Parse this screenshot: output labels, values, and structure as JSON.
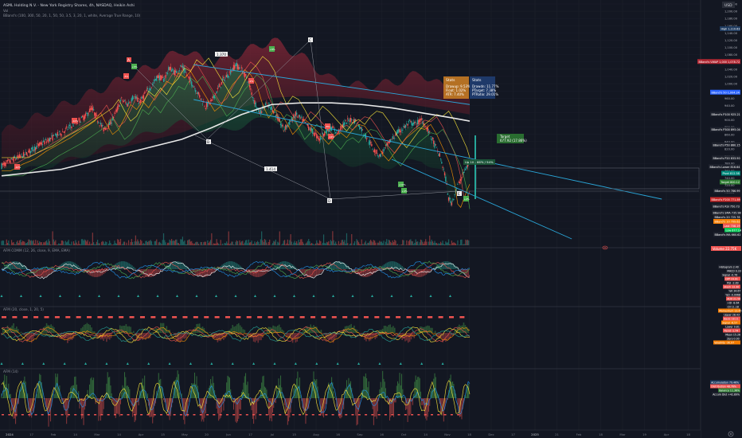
{
  "header": {
    "title": "ASML Holding N.V. - New York Registry Shares, 4h, NASDAQ, Heikin Ashi",
    "line2": "Vol",
    "line3": "BBand's (100, 300, 50, 20, 1, 50, 50, 3.5, 3, 20, 1, white, Average True Range, 10)"
  },
  "currency": "USD",
  "colors": {
    "bg": "#131722",
    "up": "#26a69a",
    "down": "#ef5350",
    "grid": "#1e222d",
    "band_red": "#6b1f2c",
    "band_green": "#1d5a3e",
    "ma_white": "#e0e0e0",
    "trend": "#2aa6d8"
  },
  "time_axis": [
    "2024",
    "17",
    "Feb",
    "14",
    "Mar",
    "14",
    "Apr",
    "15",
    "May",
    "20",
    "Jun",
    "17",
    "Jul",
    "15",
    "Aug",
    "16",
    "Sep",
    "16",
    "Oct",
    "14",
    "Nov",
    "18",
    "Dec",
    "17",
    "2025",
    "21",
    "Feb",
    "18",
    "Mar",
    "19",
    "Apr",
    "18"
  ],
  "price_axis": [
    "1,220.00",
    "1,200.00",
    "1,180.00",
    "1,160.00",
    "1,140.00",
    "1,120.00",
    "1,100.00",
    "1,080.00",
    "1,060.00",
    "1,040.00",
    "1,020.00",
    "1,000.00",
    "980.00",
    "960.00",
    "940.00",
    "920.00",
    "900.00",
    "880.00",
    "860.00",
    "840.00",
    "820.00",
    "800.00",
    "780.00",
    "760.00",
    "740.00",
    "720.00",
    "700.00",
    "680.00",
    "660.00",
    "640.00",
    "620.00",
    "600.00",
    "580.00"
  ],
  "price_badges": [
    {
      "text": "High 1,110.63",
      "color": "#1e3a5f",
      "y": 0.96
    },
    {
      "text": "BBand's VWAP 1,000 1,078.72",
      "color": "#b22833",
      "y": 0.81
    },
    {
      "text": "BBand's 50 1,004.24",
      "color": "#2962ff",
      "y": 0.67
    },
    {
      "text": "BBand's P100 925.21",
      "color": "#1e222d",
      "y": 0.57
    },
    {
      "text": "BBand's P300 895.04",
      "color": "#1e222d",
      "y": 0.5
    },
    {
      "text": "BBand's P50 860.15",
      "color": "#1e222d",
      "y": 0.43
    },
    {
      "text": "BBand's P20 833.90",
      "color": "#1e222d",
      "y": 0.37
    },
    {
      "text": "BBand's Lower 816.64",
      "color": "#1e222d",
      "y": 0.33
    },
    {
      "text": "Pivot 812.58",
      "color": "#00897b",
      "y": 0.3
    },
    {
      "text": "Target 800.12",
      "color": "#2e7d32",
      "y": 0.26
    },
    {
      "text": "BBand's 50 786.99",
      "color": "#1e222d",
      "y": 0.22
    },
    {
      "text": "BBand's P200 771.89",
      "color": "#c62828",
      "y": 0.18
    },
    {
      "text": "BBand's RSI 750.73",
      "color": "#1e222d",
      "y": 0.15
    },
    {
      "text": "BBand's SMA 735.98",
      "color": "#1e222d",
      "y": 0.12
    },
    {
      "text": "BBand's 20 725.78",
      "color": "#1e222d",
      "y": 0.1
    },
    {
      "text": "BBand's 10 709.62",
      "color": "#f57c00",
      "y": 0.08
    },
    {
      "text": "Last 708.19",
      "color": "#ef5350",
      "y": 0.06
    },
    {
      "text": "Low 677.14",
      "color": "#00c853",
      "y": 0.04
    },
    {
      "text": "BBand's MA 660.62",
      "color": "#1e222d",
      "y": 0.02
    }
  ],
  "annotations": {
    "zone_labels": [
      "-10%",
      "-10%",
      "-5%",
      "+5%",
      "-2%",
      "+8%",
      "-14%",
      "-8%",
      "+10%",
      "+4%",
      "+2%"
    ],
    "wave_labels": [
      "A",
      "B",
      "C",
      "D",
      "E"
    ],
    "ratio_labels": [
      "1.370",
      "1.414"
    ],
    "box_label": "Up 10 - 66% / 54%",
    "target_label_1": "Target",
    "target_label_2": "677.92 (17.86%)",
    "stats_box_orange": {
      "title": "Stats",
      "lines": [
        "Drawup: 9.53%",
        "Float: 1.02%",
        "ATR: 7.40%"
      ]
    },
    "stats_box_blue": {
      "title": "Stats",
      "lines": [
        "Drawdn: 11.77%",
        "PTarget: 7.38%",
        "PTRatio: 29.01%"
      ]
    },
    "volume_label": "Volume 22.75K"
  },
  "panes": {
    "p1": {
      "label": "AFM COMM (12, 26, close, 9, EMA, EMA)",
      "badges": [
        {
          "text": "Histogram 2.40",
          "color": "#1e222d"
        },
        {
          "text": "MACD 0.33",
          "color": "#1e222d"
        },
        {
          "text": "Signal -0.76",
          "color": "#1e222d"
        },
        {
          "text": "Diff 16.91",
          "color": "#ef5350"
        },
        {
          "text": "RSI -2.89",
          "color": "#1e222d"
        },
        {
          "text": "Stoch 12.30",
          "color": "#ef5350"
        },
        {
          "text": "%K 34.67",
          "color": "#1e222d"
        },
        {
          "text": "%D -0.0068",
          "color": "#1e222d"
        },
        {
          "text": "ADX 21.54",
          "color": "#ef5350"
        },
        {
          "text": "+DI -8.64",
          "color": "#1e222d"
        },
        {
          "text": "-DI 11.18",
          "color": "#1e222d"
        },
        {
          "text": "ATR 19.18",
          "color": "#1e222d"
        }
      ]
    },
    "p2": {
      "label": "AFM (20, close, 1, 20, 5)",
      "badges": [
        {
          "text": "Momentum 13.45",
          "color": "#f57c00"
        },
        {
          "text": "Upper 28.43",
          "color": "#1e222d"
        },
        {
          "text": "Basis 18.11",
          "color": "#ef5350"
        },
        {
          "text": "Signal -6.57",
          "color": "#f57c00"
        },
        {
          "text": "Lower 9.81",
          "color": "#1e222d"
        },
        {
          "text": "Trend -1.74",
          "color": "#ef5350"
        },
        {
          "text": "Mean 15.26",
          "color": "#1e222d"
        },
        {
          "text": "Zero 0.00",
          "color": "#1e222d"
        },
        {
          "text": "Volatility -30.97",
          "color": "#f57c00"
        }
      ]
    },
    "p3": {
      "label": "AFM (14)",
      "badges": [
        {
          "text": "Accumulation 79.46%",
          "color": "#1e3a5f"
        },
        {
          "text": "Distribution 48.76%",
          "color": "#ef5350"
        },
        {
          "text": "Balance 11.36%",
          "color": "#2e7d32"
        },
        {
          "text": "Accum Dist +42.89%",
          "color": "#1e222d"
        }
      ]
    }
  },
  "icons": [
    "settings-icon",
    "eye-icon"
  ],
  "chart_data": {
    "type": "candlestick",
    "title": "ASML Holding N.V. - New York Registry Shares, 4h, NASDAQ, Heikin Ashi",
    "ylim": [
      580,
      1240
    ],
    "price_path": [
      [
        0,
        800
      ],
      [
        4,
        820
      ],
      [
        8,
        835
      ],
      [
        12,
        860
      ],
      [
        16,
        880
      ],
      [
        20,
        900
      ],
      [
        24,
        925
      ],
      [
        28,
        950
      ],
      [
        30,
        975
      ],
      [
        32,
        940
      ],
      [
        34,
        910
      ],
      [
        36,
        925
      ],
      [
        38,
        960
      ],
      [
        40,
        1000
      ],
      [
        42,
        985
      ],
      [
        44,
        1010
      ],
      [
        46,
        990
      ],
      [
        48,
        1020
      ],
      [
        50,
        1040
      ],
      [
        52,
        1070
      ],
      [
        54,
        1060
      ],
      [
        56,
        1095
      ],
      [
        58,
        1080
      ],
      [
        60,
        1100
      ],
      [
        62,
        1070
      ],
      [
        64,
        1040
      ],
      [
        66,
        1010
      ],
      [
        68,
        980
      ],
      [
        70,
        995
      ],
      [
        72,
        1030
      ],
      [
        74,
        1060
      ],
      [
        76,
        1080
      ],
      [
        78,
        1105
      ],
      [
        80,
        1090
      ],
      [
        82,
        1060
      ],
      [
        84,
        1000
      ],
      [
        86,
        960
      ],
      [
        88,
        985
      ],
      [
        90,
        975
      ],
      [
        92,
        945
      ],
      [
        94,
        910
      ],
      [
        96,
        930
      ],
      [
        98,
        955
      ],
      [
        100,
        940
      ],
      [
        102,
        920
      ],
      [
        104,
        900
      ],
      [
        106,
        880
      ],
      [
        108,
        905
      ],
      [
        110,
        915
      ],
      [
        112,
        900
      ],
      [
        114,
        925
      ],
      [
        116,
        940
      ],
      [
        118,
        935
      ],
      [
        120,
        910
      ],
      [
        122,
        880
      ],
      [
        124,
        850
      ],
      [
        126,
        830
      ],
      [
        128,
        855
      ],
      [
        130,
        880
      ],
      [
        132,
        900
      ],
      [
        134,
        915
      ],
      [
        136,
        930
      ],
      [
        138,
        925
      ],
      [
        140,
        940
      ],
      [
        142,
        910
      ],
      [
        144,
        870
      ],
      [
        146,
        830
      ],
      [
        147,
        800
      ],
      [
        148,
        760
      ],
      [
        149,
        700
      ],
      [
        150,
        690
      ],
      [
        152,
        740
      ],
      [
        154,
        780
      ],
      [
        156,
        812
      ]
    ],
    "sma_path": [
      [
        0,
        770
      ],
      [
        20,
        790
      ],
      [
        40,
        835
      ],
      [
        60,
        880
      ],
      [
        70,
        915
      ],
      [
        80,
        955
      ],
      [
        90,
        985
      ],
      [
        100,
        990
      ],
      [
        110,
        990
      ],
      [
        120,
        985
      ],
      [
        130,
        975
      ],
      [
        140,
        960
      ],
      [
        150,
        945
      ],
      [
        156,
        935
      ]
    ],
    "band_upper": [
      [
        0,
        900
      ],
      [
        10,
        940
      ],
      [
        20,
        980
      ],
      [
        30,
        1020
      ],
      [
        40,
        1060
      ],
      [
        50,
        1100
      ],
      [
        60,
        1150
      ],
      [
        70,
        1110
      ],
      [
        80,
        1140
      ],
      [
        90,
        1180
      ],
      [
        100,
        1130
      ],
      [
        110,
        1060
      ],
      [
        120,
        1040
      ],
      [
        130,
        1050
      ],
      [
        140,
        1080
      ],
      [
        150,
        1020
      ],
      [
        156,
        990
      ]
    ],
    "band_lower": [
      [
        0,
        770
      ],
      [
        10,
        790
      ],
      [
        20,
        810
      ],
      [
        30,
        840
      ],
      [
        40,
        870
      ],
      [
        50,
        900
      ],
      [
        60,
        930
      ],
      [
        70,
        900
      ],
      [
        80,
        920
      ],
      [
        90,
        950
      ],
      [
        100,
        880
      ],
      [
        110,
        820
      ],
      [
        120,
        800
      ],
      [
        130,
        800
      ],
      [
        140,
        820
      ],
      [
        150,
        760
      ],
      [
        156,
        730
      ]
    ],
    "trend_lines": [
      {
        "from": [
          64,
          1105
        ],
        "to": [
          156,
          985
        ]
      },
      {
        "from": [
          64,
          1000
        ],
        "to": [
          220,
          700
        ]
      },
      {
        "from": [
          130,
          820
        ],
        "to": [
          190,
          580
        ]
      }
    ],
    "volume_max": 1,
    "series": [
      {
        "name": "Histogram",
        "pane": "p1"
      },
      {
        "name": "Momentum",
        "pane": "p2"
      },
      {
        "name": "Accumulation",
        "pane": "p3"
      }
    ]
  }
}
